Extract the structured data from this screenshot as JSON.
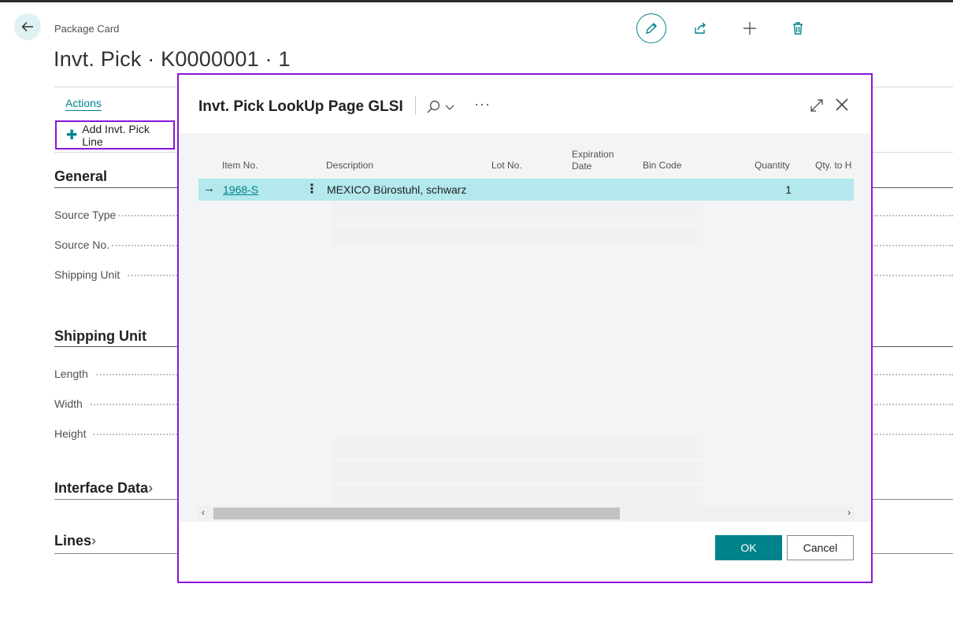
{
  "page": {
    "caption": "Package Card",
    "title": "Invt. Pick · K0000001 · 1",
    "actions_label": "Actions",
    "add_line_label": "Add Invt. Pick Line"
  },
  "icons": {
    "back": "back-arrow-icon",
    "edit": "pencil-icon",
    "share": "share-icon",
    "new": "plus-icon",
    "delete": "trash-icon"
  },
  "general": {
    "heading": "General",
    "fields": [
      "Source Type",
      "Source No.",
      "Shipping Unit"
    ]
  },
  "shipping_unit": {
    "heading": "Shipping Unit",
    "fields": [
      "Length",
      "Width",
      "Height"
    ]
  },
  "interface_data": {
    "heading": "Interface Data"
  },
  "lines": {
    "heading": "Lines"
  },
  "dialog": {
    "title": "Invt. Pick LookUp Page GLSI",
    "more": "···",
    "columns": {
      "item_no": "Item No.",
      "description": "Description",
      "lot_no": "Lot No.",
      "expiration_line1": "Expiration",
      "expiration_line2": "Date",
      "bin_code": "Bin Code",
      "quantity": "Quantity",
      "qty_to_handle": "Qty. to H"
    },
    "rows": [
      {
        "item_no": "1968-S",
        "description": "MEXICO Bürostuhl, schwarz",
        "lot_no": "",
        "expiration_date": "",
        "bin_code": "",
        "quantity": "1",
        "qty_to_handle": ""
      }
    ],
    "ok_label": "OK",
    "cancel_label": "Cancel"
  },
  "colors": {
    "accent": "#00838a",
    "highlight_border": "#8a16d9",
    "selected_row": "#b3e8ec"
  }
}
